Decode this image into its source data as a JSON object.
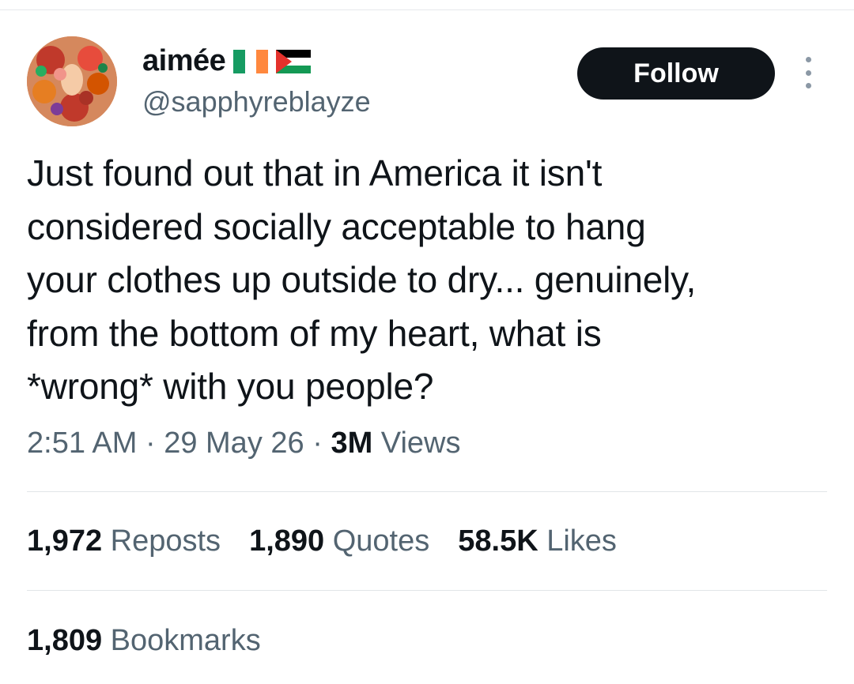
{
  "author": {
    "display_name": "aimée",
    "flags": [
      "ireland-flag-icon",
      "palestine-flag-icon"
    ],
    "handle": "@sapphyreblayze"
  },
  "follow_label": "Follow",
  "tweet": {
    "lines": [
      "Just found out that in America it isn't",
      "considered socially acceptable to hang",
      "your clothes up outside to dry... genuinely,",
      "from the bottom of my heart, what is",
      "*wrong* with you people?"
    ]
  },
  "meta": {
    "time": "2:51 AM",
    "sep1": " · ",
    "date": "29 May 26",
    "sep2": " · ",
    "views_count": "3M",
    "views_label": " Views"
  },
  "stats": {
    "reposts": {
      "count": "1,972",
      "label": "Reposts"
    },
    "quotes": {
      "count": "1,890",
      "label": "Quotes"
    },
    "likes": {
      "count": "58.5K",
      "label": "Likes"
    },
    "bookmarks": {
      "count": "1,809",
      "label": "Bookmarks"
    }
  },
  "colors": {
    "text": "#0f1419",
    "secondary": "#536471",
    "follow_bg": "#0f1419",
    "divider": "#e1e5e8"
  }
}
